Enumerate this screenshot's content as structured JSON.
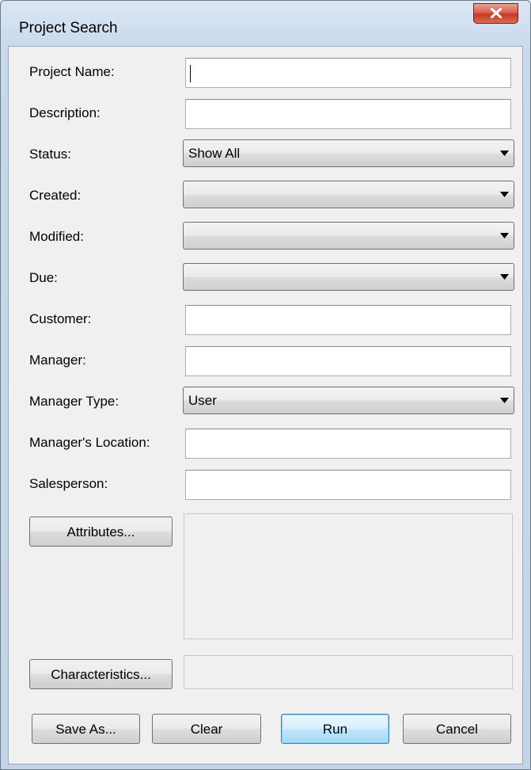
{
  "window": {
    "title": "Project Search"
  },
  "fields": {
    "project_name": {
      "label": "Project Name:",
      "value": ""
    },
    "description": {
      "label": "Description:",
      "value": ""
    },
    "status": {
      "label": "Status:",
      "value": "Show All"
    },
    "created": {
      "label": "Created:",
      "value": ""
    },
    "modified": {
      "label": "Modified:",
      "value": ""
    },
    "due": {
      "label": "Due:",
      "value": ""
    },
    "customer": {
      "label": "Customer:",
      "value": ""
    },
    "manager": {
      "label": "Manager:",
      "value": ""
    },
    "manager_type": {
      "label": "Manager Type:",
      "value": "User"
    },
    "managers_location": {
      "label": "Manager's Location:",
      "value": ""
    },
    "salesperson": {
      "label": "Salesperson:",
      "value": ""
    }
  },
  "buttons": {
    "attributes": "Attributes...",
    "characteristics": "Characteristics...",
    "save_as": "Save As...",
    "clear": "Clear",
    "run": "Run",
    "cancel": "Cancel"
  },
  "icons": {
    "close": "close-icon",
    "dropdown": "chevron-down-icon"
  }
}
